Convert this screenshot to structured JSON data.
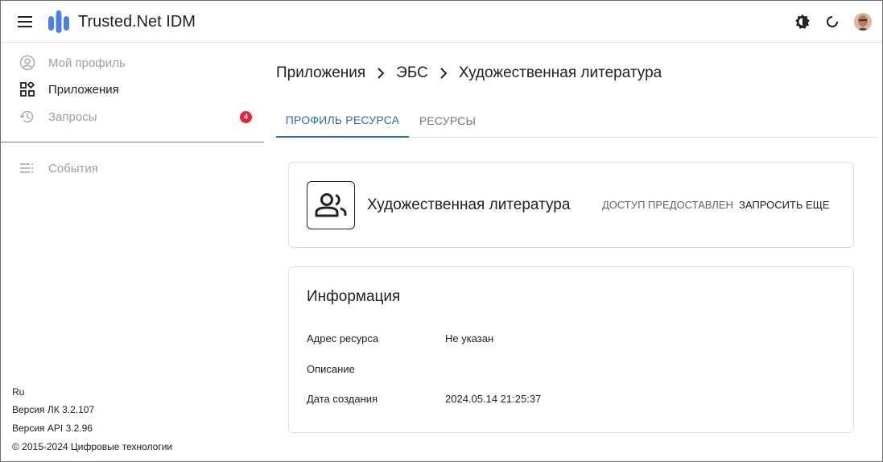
{
  "app": {
    "title": "Trusted.Net IDM"
  },
  "colors": {
    "accent": "#2d6bb5",
    "badge": "#e8243c",
    "logo": "#4f7ee0"
  },
  "icons": {
    "menu": "menu-icon",
    "theme": "brightness-icon",
    "refresh": "refresh-icon",
    "avatar": "avatar-image"
  },
  "sidebar": {
    "items": [
      {
        "label": "Мой профиль",
        "icon": "account-circle-icon",
        "state": "disabled"
      },
      {
        "label": "Приложения",
        "icon": "apps-grid-icon",
        "state": "active"
      },
      {
        "label": "Запросы",
        "icon": "history-icon",
        "state": "disabled",
        "badge": "4"
      },
      {
        "label": "События",
        "icon": "list-icon",
        "state": "disabled"
      }
    ],
    "footer": {
      "lang": "Ru",
      "version_lk": "Версия ЛК 3.2.107",
      "version_api": "Версия API 3.2.96",
      "copyright": "© 2015-2024 Цифровые технологии"
    }
  },
  "breadcrumb": [
    "Приложения",
    "ЭБС",
    "Художественная литература"
  ],
  "tabs": [
    {
      "label": "ПРОФИЛЬ РЕСУРСА",
      "active": true
    },
    {
      "label": "РЕСУРСЫ",
      "active": false
    }
  ],
  "resource": {
    "name": "Художественная литература",
    "icon": "group-icon",
    "access_status": "ДОСТУП ПРЕДОСТАВЛЕН",
    "request_more": "ЗАПРОСИТЬ ЕЩЕ"
  },
  "info": {
    "title": "Информация",
    "rows": [
      {
        "label": "Адрес ресурса",
        "value": "Не указан"
      },
      {
        "label": "Описание",
        "value": ""
      },
      {
        "label": "Дата создания",
        "value": "2024.05.14 21:25:37"
      }
    ]
  }
}
